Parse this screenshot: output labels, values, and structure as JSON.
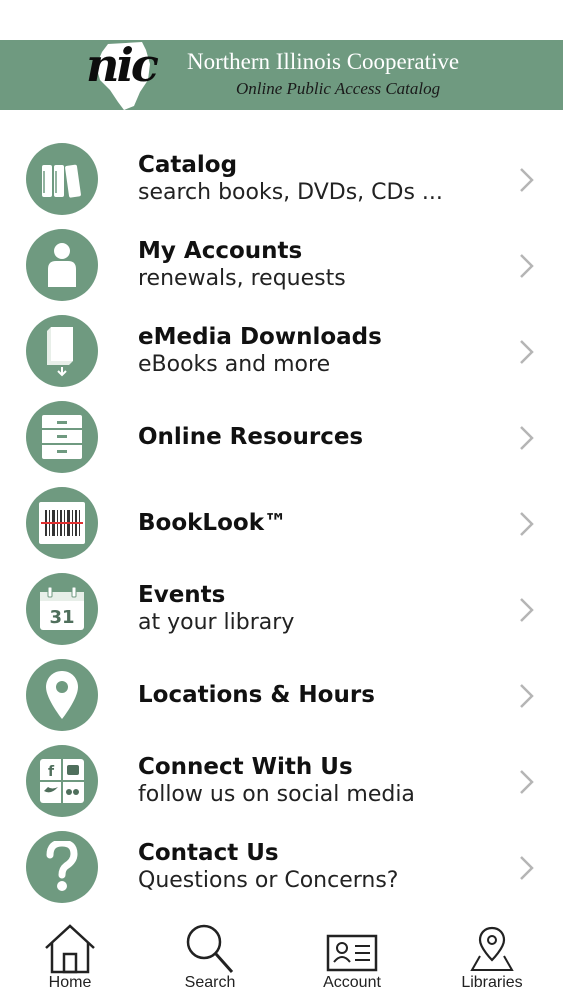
{
  "header": {
    "logo_text": "nic",
    "title": "Northern Illinois Cooperative",
    "subtitle": "Online Public Access Catalog",
    "color": "#6f9a80"
  },
  "menu": [
    {
      "icon": "books-icon",
      "label": "Catalog",
      "sub": "search books, DVDs, CDs ..."
    },
    {
      "icon": "person-icon",
      "label": "My Accounts",
      "sub": "renewals, requests"
    },
    {
      "icon": "ebook-download-icon",
      "label": "eMedia Downloads",
      "sub": "eBooks and more"
    },
    {
      "icon": "file-cabinet-icon",
      "label": "Online Resources",
      "sub": ""
    },
    {
      "icon": "barcode-icon",
      "label": "BookLook™",
      "sub": ""
    },
    {
      "icon": "calendar-icon",
      "label": "Events",
      "sub": "at your library",
      "calendar_day": "31"
    },
    {
      "icon": "map-pin-icon",
      "label": "Locations & Hours",
      "sub": ""
    },
    {
      "icon": "social-media-icon",
      "label": "Connect With Us",
      "sub": "follow us on social media"
    },
    {
      "icon": "question-icon",
      "label": "Contact Us",
      "sub": "Questions or Concerns?"
    }
  ],
  "tabs": [
    {
      "icon": "home-icon",
      "label": "Home"
    },
    {
      "icon": "search-icon",
      "label": "Search"
    },
    {
      "icon": "account-card-icon",
      "label": "Account"
    },
    {
      "icon": "location-icon",
      "label": "Libraries"
    }
  ]
}
